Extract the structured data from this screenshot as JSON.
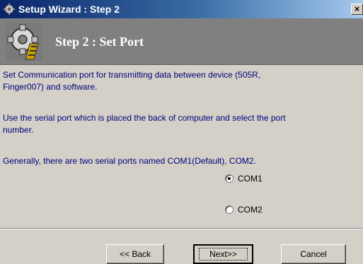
{
  "window": {
    "title": "Setup Wizard : Step 2",
    "close_label": "×"
  },
  "header": {
    "title": "Step 2 : Set Port",
    "icon": "gear-icon"
  },
  "content": {
    "paragraphs": [
      "Set Communication port for transmitting data between  device (505R, Finger007) and software.",
      "Use the serial port which is placed the back of computer and select the port number.",
      "Generally, there are two serial ports named COM1(Default), COM2."
    ],
    "ports": [
      {
        "label": "COM1",
        "selected": true
      },
      {
        "label": "COM2",
        "selected": false
      }
    ]
  },
  "buttons": {
    "back": "<< Back",
    "next": "Next>>",
    "cancel": "Cancel"
  },
  "colors": {
    "text_blue": "#00007a",
    "titlebar_start": "#0a246a",
    "header_bg": "#808080"
  }
}
